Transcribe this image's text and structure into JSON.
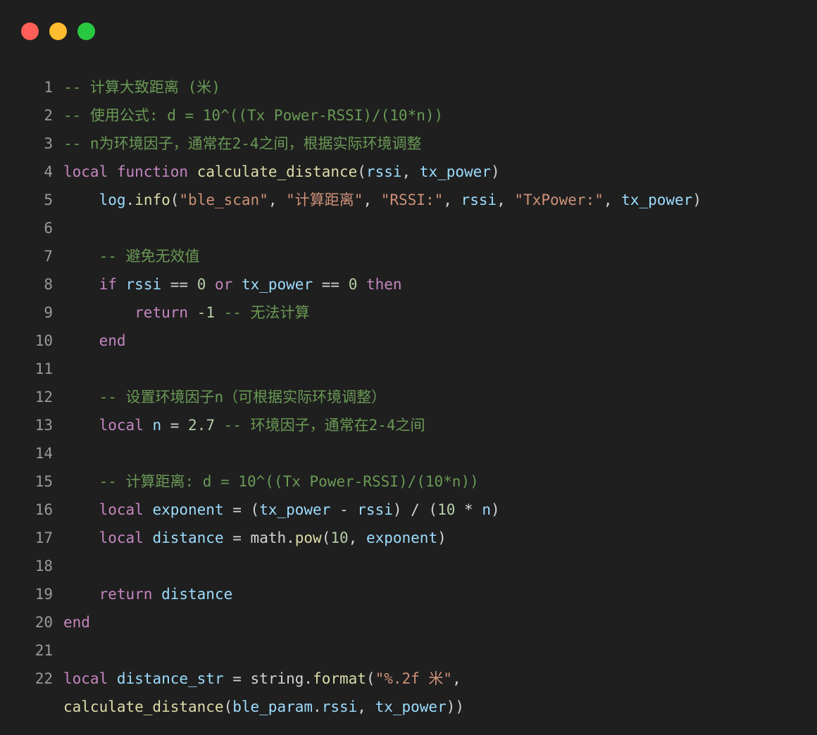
{
  "window": {
    "traffic_lights": [
      {
        "name": "close",
        "color": "#ff5f57"
      },
      {
        "name": "minimize",
        "color": "#febc2e"
      },
      {
        "name": "zoom",
        "color": "#28c840"
      }
    ]
  },
  "code": {
    "language": "lua",
    "lines": [
      {
        "n": "1",
        "tokens": [
          {
            "t": "cmt",
            "v": "-- 计算大致距离 (米)"
          }
        ]
      },
      {
        "n": "2",
        "tokens": [
          {
            "t": "cmt",
            "v": "-- 使用公式: d = 10^((Tx Power-RSSI)/(10*n))"
          }
        ]
      },
      {
        "n": "3",
        "tokens": [
          {
            "t": "cmt",
            "v": "-- n为环境因子，通常在2-4之间，根据实际环境调整"
          }
        ]
      },
      {
        "n": "4",
        "tokens": [
          {
            "t": "kw",
            "v": "local"
          },
          {
            "t": "pl",
            "v": " "
          },
          {
            "t": "kw",
            "v": "function"
          },
          {
            "t": "pl",
            "v": " "
          },
          {
            "t": "fn",
            "v": "calculate_distance"
          },
          {
            "t": "pl",
            "v": "("
          },
          {
            "t": "var",
            "v": "rssi"
          },
          {
            "t": "pl",
            "v": ", "
          },
          {
            "t": "var",
            "v": "tx_power"
          },
          {
            "t": "pl",
            "v": ")"
          }
        ]
      },
      {
        "n": "5",
        "tokens": [
          {
            "t": "pl",
            "v": "    "
          },
          {
            "t": "var",
            "v": "log"
          },
          {
            "t": "pl",
            "v": "."
          },
          {
            "t": "fn",
            "v": "info"
          },
          {
            "t": "pl",
            "v": "("
          },
          {
            "t": "str",
            "v": "\"ble_scan\""
          },
          {
            "t": "pl",
            "v": ", "
          },
          {
            "t": "str",
            "v": "\"计算距离\""
          },
          {
            "t": "pl",
            "v": ", "
          },
          {
            "t": "str",
            "v": "\"RSSI:\""
          },
          {
            "t": "pl",
            "v": ", "
          },
          {
            "t": "var",
            "v": "rssi"
          },
          {
            "t": "pl",
            "v": ", "
          },
          {
            "t": "str",
            "v": "\"TxPower:\""
          },
          {
            "t": "pl",
            "v": ", "
          },
          {
            "t": "var",
            "v": "tx_power"
          },
          {
            "t": "pl",
            "v": ")"
          }
        ]
      },
      {
        "n": "6",
        "tokens": []
      },
      {
        "n": "7",
        "tokens": [
          {
            "t": "pl",
            "v": "    "
          },
          {
            "t": "cmt",
            "v": "-- 避免无效值"
          }
        ]
      },
      {
        "n": "8",
        "tokens": [
          {
            "t": "pl",
            "v": "    "
          },
          {
            "t": "kw",
            "v": "if"
          },
          {
            "t": "pl",
            "v": " "
          },
          {
            "t": "var",
            "v": "rssi"
          },
          {
            "t": "op",
            "v": " == "
          },
          {
            "t": "num",
            "v": "0"
          },
          {
            "t": "pl",
            "v": " "
          },
          {
            "t": "kw",
            "v": "or"
          },
          {
            "t": "pl",
            "v": " "
          },
          {
            "t": "var",
            "v": "tx_power"
          },
          {
            "t": "op",
            "v": " == "
          },
          {
            "t": "num",
            "v": "0"
          },
          {
            "t": "pl",
            "v": " "
          },
          {
            "t": "kw",
            "v": "then"
          }
        ]
      },
      {
        "n": "9",
        "tokens": [
          {
            "t": "pl",
            "v": "        "
          },
          {
            "t": "kw",
            "v": "return"
          },
          {
            "t": "pl",
            "v": " "
          },
          {
            "t": "num",
            "v": "-1"
          },
          {
            "t": "pl",
            "v": " "
          },
          {
            "t": "cmt",
            "v": "-- 无法计算"
          }
        ]
      },
      {
        "n": "10",
        "tokens": [
          {
            "t": "pl",
            "v": "    "
          },
          {
            "t": "kw",
            "v": "end"
          }
        ]
      },
      {
        "n": "11",
        "tokens": []
      },
      {
        "n": "12",
        "tokens": [
          {
            "t": "pl",
            "v": "    "
          },
          {
            "t": "cmt",
            "v": "-- 设置环境因子n（可根据实际环境调整）"
          }
        ]
      },
      {
        "n": "13",
        "tokens": [
          {
            "t": "pl",
            "v": "    "
          },
          {
            "t": "kw",
            "v": "local"
          },
          {
            "t": "pl",
            "v": " "
          },
          {
            "t": "var",
            "v": "n"
          },
          {
            "t": "op",
            "v": " = "
          },
          {
            "t": "num",
            "v": "2.7"
          },
          {
            "t": "pl",
            "v": " "
          },
          {
            "t": "cmt",
            "v": "-- 环境因子，通常在2-4之间"
          }
        ]
      },
      {
        "n": "14",
        "tokens": []
      },
      {
        "n": "15",
        "tokens": [
          {
            "t": "pl",
            "v": "    "
          },
          {
            "t": "cmt",
            "v": "-- 计算距离: d = 10^((Tx Power-RSSI)/(10*n))"
          }
        ]
      },
      {
        "n": "16",
        "tokens": [
          {
            "t": "pl",
            "v": "    "
          },
          {
            "t": "kw",
            "v": "local"
          },
          {
            "t": "pl",
            "v": " "
          },
          {
            "t": "var",
            "v": "exponent"
          },
          {
            "t": "op",
            "v": " = ("
          },
          {
            "t": "var",
            "v": "tx_power"
          },
          {
            "t": "op",
            "v": " - "
          },
          {
            "t": "var",
            "v": "rssi"
          },
          {
            "t": "op",
            "v": ") / ("
          },
          {
            "t": "num",
            "v": "10"
          },
          {
            "t": "op",
            "v": " * "
          },
          {
            "t": "var",
            "v": "n"
          },
          {
            "t": "op",
            "v": ")"
          }
        ]
      },
      {
        "n": "17",
        "tokens": [
          {
            "t": "pl",
            "v": "    "
          },
          {
            "t": "kw",
            "v": "local"
          },
          {
            "t": "pl",
            "v": " "
          },
          {
            "t": "var",
            "v": "distance"
          },
          {
            "t": "op",
            "v": " = "
          },
          {
            "t": "pl",
            "v": "math."
          },
          {
            "t": "fn",
            "v": "pow"
          },
          {
            "t": "pl",
            "v": "("
          },
          {
            "t": "num",
            "v": "10"
          },
          {
            "t": "pl",
            "v": ", "
          },
          {
            "t": "var",
            "v": "exponent"
          },
          {
            "t": "pl",
            "v": ")"
          }
        ]
      },
      {
        "n": "18",
        "tokens": []
      },
      {
        "n": "19",
        "tokens": [
          {
            "t": "pl",
            "v": "    "
          },
          {
            "t": "kw",
            "v": "return"
          },
          {
            "t": "pl",
            "v": " "
          },
          {
            "t": "var",
            "v": "distance"
          }
        ]
      },
      {
        "n": "20",
        "tokens": [
          {
            "t": "kw",
            "v": "end"
          }
        ]
      },
      {
        "n": "21",
        "tokens": []
      },
      {
        "n": "22",
        "wrap": true,
        "tokens": [
          {
            "t": "kw",
            "v": "local"
          },
          {
            "t": "pl",
            "v": " "
          },
          {
            "t": "var",
            "v": "distance_str"
          },
          {
            "t": "op",
            "v": " = "
          },
          {
            "t": "pl",
            "v": "string."
          },
          {
            "t": "fn",
            "v": "format"
          },
          {
            "t": "pl",
            "v": "("
          },
          {
            "t": "str",
            "v": "\"%.2f 米\""
          },
          {
            "t": "pl",
            "v": ",\n"
          },
          {
            "t": "fn",
            "v": "calculate_distance"
          },
          {
            "t": "pl",
            "v": "("
          },
          {
            "t": "var",
            "v": "ble_param"
          },
          {
            "t": "pl",
            "v": "."
          },
          {
            "t": "var",
            "v": "rssi"
          },
          {
            "t": "pl",
            "v": ", "
          },
          {
            "t": "var",
            "v": "tx_power"
          },
          {
            "t": "pl",
            "v": "))"
          }
        ]
      }
    ]
  }
}
